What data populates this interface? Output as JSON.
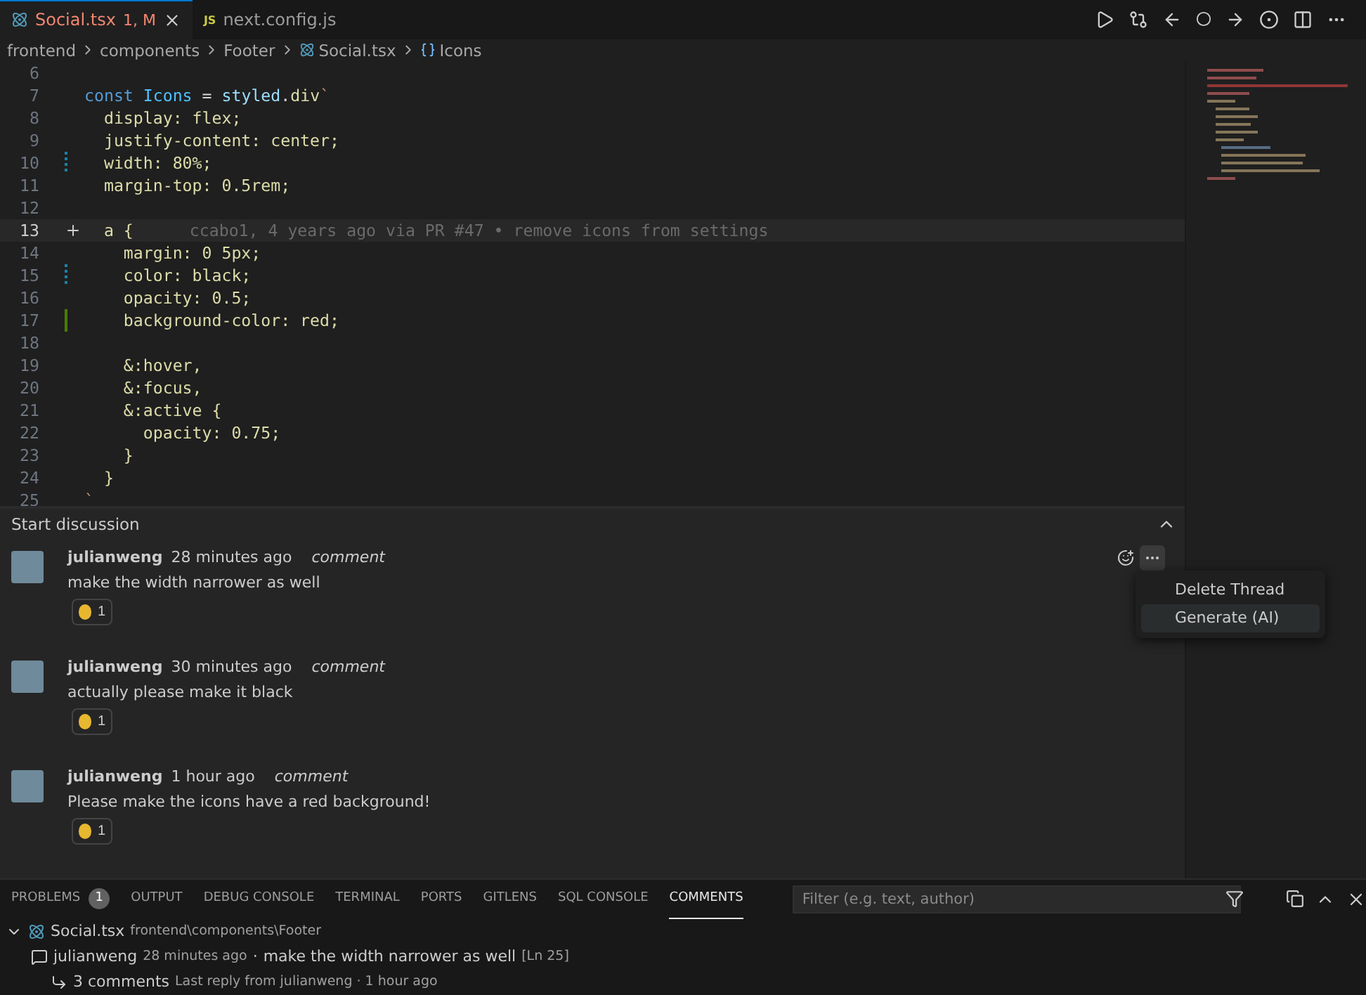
{
  "editor_tabs": [
    {
      "label": "Social.tsx",
      "badge": "1, M",
      "kind": "react",
      "selected": true
    },
    {
      "label": "next.config.js",
      "icon_text": "JS",
      "kind": "script",
      "selected": false
    }
  ],
  "breadcrumb": [
    {
      "label": "frontend",
      "kind": "folder"
    },
    {
      "label": "components",
      "kind": "folder"
    },
    {
      "label": "Footer",
      "kind": "folder"
    },
    {
      "label": "Social.tsx",
      "kind": "file"
    },
    {
      "label": "Icons",
      "kind": "symbol"
    }
  ],
  "code_lines": [
    {
      "number": "6",
      "kind": "plain",
      "current": false
    },
    {
      "number": "7",
      "kind": "plain",
      "current": false,
      "tokens": [
        {
          "text": "const ",
          "kind": "keyword"
        },
        {
          "text": "Icons",
          "kind": "variable"
        },
        {
          "text": " = ",
          "kind": "plain"
        },
        {
          "text": "styled",
          "kind": "object"
        },
        {
          "text": ".",
          "kind": "plain"
        },
        {
          "text": "div",
          "kind": "function"
        },
        {
          "text": "`",
          "kind": "string"
        }
      ]
    },
    {
      "number": "8",
      "kind": "plain",
      "current": false,
      "tokens": [
        {
          "text": "  display: flex;",
          "kind": "css"
        }
      ]
    },
    {
      "number": "9",
      "kind": "plain",
      "current": false,
      "tokens": [
        {
          "text": "  justify-content: center;",
          "kind": "css"
        }
      ]
    },
    {
      "number": "10",
      "kind": "modified",
      "current": false,
      "tokens": [
        {
          "text": "  width: 80%;",
          "kind": "css"
        }
      ]
    },
    {
      "number": "11",
      "kind": "plain",
      "current": false,
      "tokens": [
        {
          "text": "  margin-top: 0.5rem;",
          "kind": "css"
        }
      ]
    },
    {
      "number": "12",
      "kind": "plain",
      "current": false
    },
    {
      "number": "13",
      "kind": "comment",
      "current": true,
      "tokens": [
        {
          "text": "  a {",
          "kind": "css"
        }
      ],
      "blame": "ccabo1, 4 years ago via PR #47 • remove icons from settings"
    },
    {
      "number": "14",
      "kind": "plain",
      "current": false,
      "tokens": [
        {
          "text": "    margin: 0 5px;",
          "kind": "css"
        }
      ]
    },
    {
      "number": "15",
      "kind": "modified",
      "current": false,
      "tokens": [
        {
          "text": "    color: black;",
          "kind": "css"
        }
      ]
    },
    {
      "number": "16",
      "kind": "plain",
      "current": false,
      "tokens": [
        {
          "text": "    opacity: 0.5;",
          "kind": "css"
        }
      ]
    },
    {
      "number": "17",
      "kind": "added",
      "current": false,
      "tokens": [
        {
          "text": "    background-color: red;",
          "kind": "css"
        }
      ]
    },
    {
      "number": "18",
      "kind": "plain",
      "current": false
    },
    {
      "number": "19",
      "kind": "plain",
      "current": false,
      "tokens": [
        {
          "text": "    &:hover,",
          "kind": "css"
        }
      ]
    },
    {
      "number": "20",
      "kind": "plain",
      "current": false,
      "tokens": [
        {
          "text": "    &:focus,",
          "kind": "css"
        }
      ]
    },
    {
      "number": "21",
      "kind": "plain",
      "current": false,
      "tokens": [
        {
          "text": "    &:active {",
          "kind": "css"
        }
      ]
    },
    {
      "number": "22",
      "kind": "plain",
      "current": false,
      "tokens": [
        {
          "text": "      opacity: 0.75;",
          "kind": "css"
        }
      ]
    },
    {
      "number": "23",
      "kind": "plain",
      "current": false,
      "tokens": [
        {
          "text": "    }",
          "kind": "css"
        }
      ]
    },
    {
      "number": "24",
      "kind": "plain",
      "current": false,
      "tokens": [
        {
          "text": "  }",
          "kind": "css"
        }
      ]
    },
    {
      "number": "25",
      "kind": "plain",
      "current": false,
      "tokens": [
        {
          "text": "`",
          "kind": "string"
        }
      ]
    }
  ],
  "discussion": {
    "title": "Start discussion",
    "comments": [
      {
        "author": "julianweng",
        "time": "28 minutes ago",
        "type": "comment",
        "body": "make the width narrower as well",
        "reaction_count": "1"
      },
      {
        "author": "julianweng",
        "time": "30 minutes ago",
        "type": "comment",
        "body": "actually please make it black",
        "reaction_count": "1"
      },
      {
        "author": "julianweng",
        "time": "1 hour ago",
        "type": "comment",
        "body": "Please make the icons have a red background!",
        "reaction_count": "1"
      }
    ],
    "menu": [
      {
        "label": "Delete Thread",
        "selected": false
      },
      {
        "label": "Generate (AI)",
        "selected": true
      }
    ]
  },
  "panel_tabs": [
    {
      "label": "PROBLEMS",
      "badge": "1",
      "selected": false
    },
    {
      "label": "OUTPUT",
      "selected": false
    },
    {
      "label": "DEBUG CONSOLE",
      "selected": false
    },
    {
      "label": "TERMINAL",
      "selected": false
    },
    {
      "label": "PORTS",
      "selected": false
    },
    {
      "label": "GITLENS",
      "selected": false
    },
    {
      "label": "SQL CONSOLE",
      "selected": false
    },
    {
      "label": "COMMENTS",
      "selected": true
    }
  ],
  "filter": {
    "placeholder": "Filter (e.g. text, author)"
  },
  "comments_tree": {
    "file": "Social.tsx",
    "path": "frontend\\components\\Footer",
    "expanded": true,
    "thread": {
      "author": "julianweng",
      "time": "28 minutes ago",
      "separator": "·",
      "text": "make the width narrower as well",
      "location": "[Ln 25]",
      "replies": "3 comments",
      "last_reply": "Last reply from julianweng · 1 hour ago"
    }
  }
}
